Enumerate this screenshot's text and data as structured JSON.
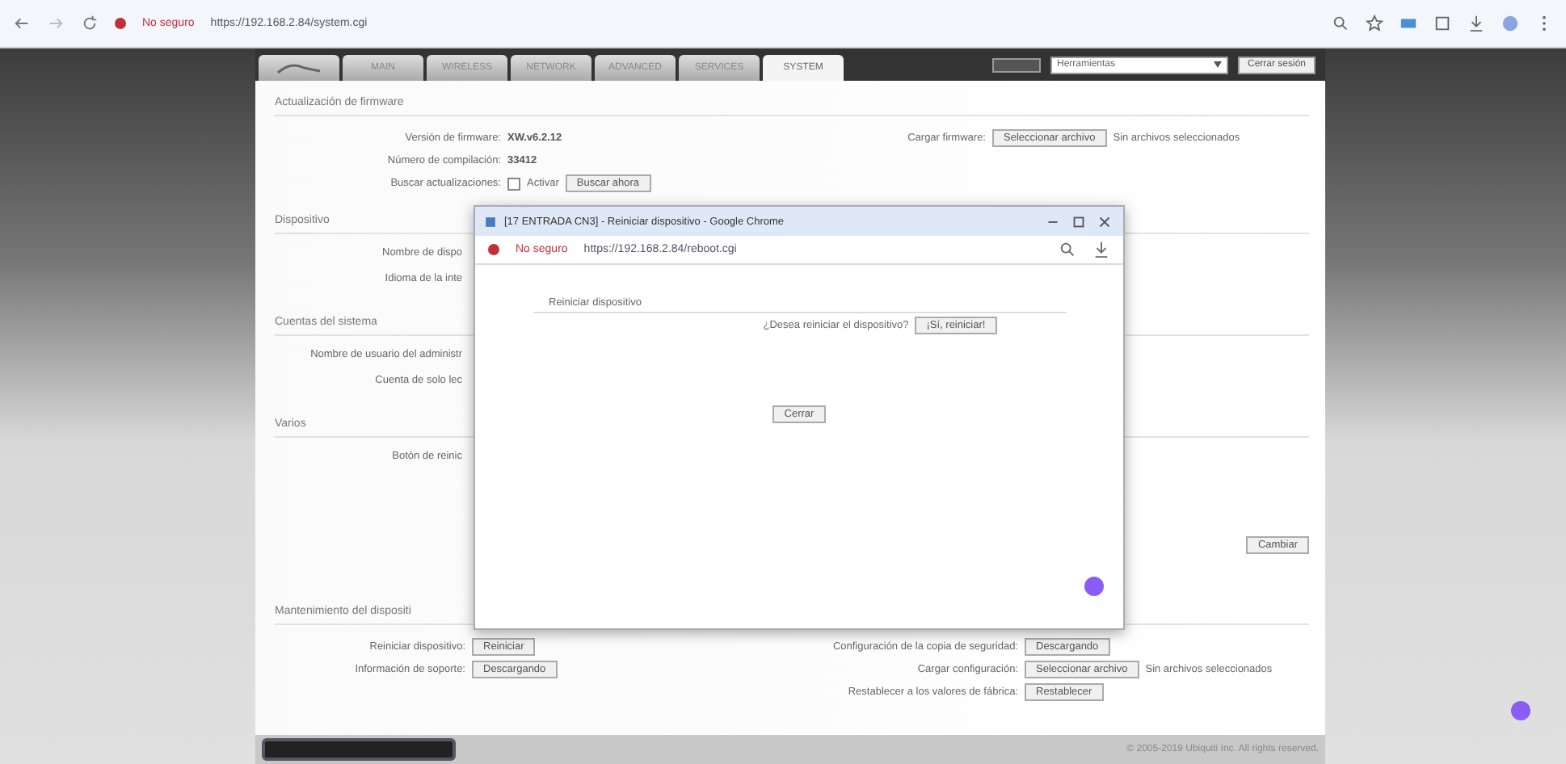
{
  "browser": {
    "security": "No seguro",
    "url": "https://192.168.2.84/system.cgi"
  },
  "nav": {
    "tabs": [
      {
        "label": "MAIN",
        "selected": false
      },
      {
        "label": "WIRELESS",
        "selected": false
      },
      {
        "label": "NETWORK",
        "selected": false
      },
      {
        "label": "ADVANCED",
        "selected": false
      },
      {
        "label": "SERVICES",
        "selected": false
      },
      {
        "label": "SYSTEM",
        "selected": true
      }
    ],
    "tools": "Herramientas",
    "logout": "Cerrar sesión"
  },
  "sections": [
    {
      "title": "Actualización de firmware",
      "left": [
        {
          "label": "Versión de firmware:",
          "items": [
            {
              "kind": "text",
              "text": "XW.v6.2.12"
            }
          ]
        },
        {
          "label": "Número de compilación:",
          "items": [
            {
              "kind": "text",
              "text": "33412"
            }
          ]
        },
        {
          "label": "Buscar actualizaciones:",
          "items": [
            {
              "kind": "checkbox",
              "label": "Activar",
              "checked": false
            },
            {
              "kind": "button",
              "label": "Buscar ahora"
            }
          ]
        }
      ],
      "right": [
        {
          "label": "Cargar firmware:",
          "items": [
            {
              "kind": "file",
              "button": "Seleccionar archivo",
              "status": "Sin archivos seleccionados"
            }
          ]
        }
      ]
    },
    {
      "title": "Dispositivo",
      "left": [
        {
          "label": "Nombre de dispo"
        },
        {
          "label": "Idioma de la inte"
        }
      ]
    },
    {
      "title": "Cuentas del sistema",
      "left": [
        {
          "label": "Nombre de usuario del administr"
        },
        {
          "label": "Cuenta de solo lec"
        }
      ]
    },
    {
      "title": "Varios",
      "left": [
        {
          "label": "Botón de reinic"
        }
      ],
      "action": "Cambiar"
    },
    {
      "title": "Mantenimiento del dispositi",
      "left": [
        {
          "label": "Reiniciar dispositivo:",
          "items": [
            {
              "kind": "button",
              "label": "Reiniciar"
            }
          ]
        },
        {
          "label": "Información de soporte:",
          "items": [
            {
              "kind": "button",
              "label": "Descargando"
            }
          ]
        }
      ],
      "right": [
        {
          "label": "Configuración de la copia de seguridad:",
          "items": [
            {
              "kind": "button",
              "label": "Descargando"
            }
          ]
        },
        {
          "label": "Cargar configuración:",
          "items": [
            {
              "kind": "file",
              "button": "Seleccionar archivo",
              "status": "Sin archivos seleccionados"
            }
          ]
        },
        {
          "label": "Restablecer a los valores de fábrica:",
          "items": [
            {
              "kind": "button",
              "label": "Restablecer"
            }
          ]
        }
      ]
    }
  ],
  "footer": "© 2005-2019 Ubiquiti Inc. All rights reserved.",
  "popup": {
    "title": "[17 ENTRADA CN3] - Reiniciar dispositivo - Google Chrome",
    "security": "No seguro",
    "url": "https://192.168.2.84/reboot.cgi",
    "heading": "Reiniciar dispositivo",
    "question": "¿Desea reiniciar el dispositivo?",
    "confirm": "¡Sí, reiniciar!",
    "close": "Cerrar"
  }
}
